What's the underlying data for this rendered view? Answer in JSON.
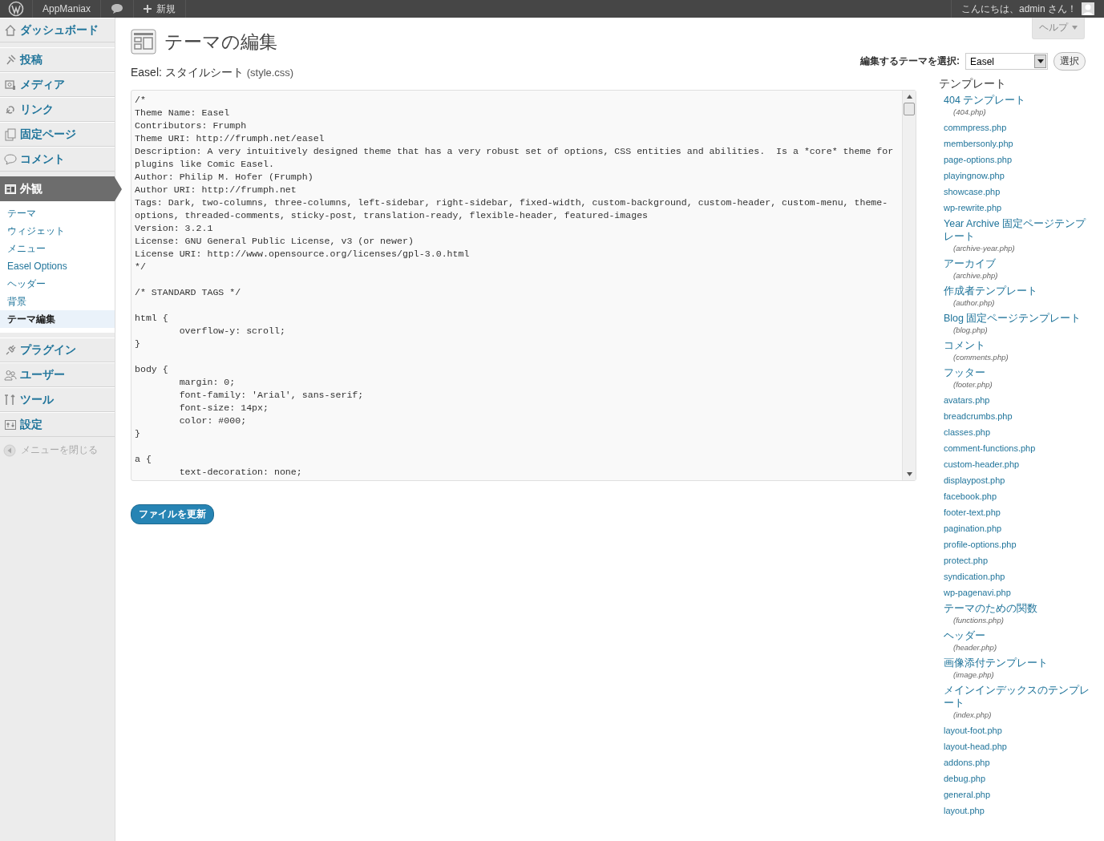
{
  "admin_bar": {
    "site": "AppManiax",
    "new": "新規",
    "greeting": "こんにちは、admin さん！"
  },
  "help": "ヘルプ",
  "menu": [
    {
      "label": "ダッシュボード",
      "selected": false
    },
    {
      "label": "投稿",
      "selected": false
    },
    {
      "label": "メディア",
      "selected": false
    },
    {
      "label": "リンク",
      "selected": false
    },
    {
      "label": "固定ページ",
      "selected": false
    },
    {
      "label": "コメント",
      "selected": false
    },
    {
      "label": "外観",
      "selected": true,
      "children": [
        {
          "label": "テーマ",
          "selected": false
        },
        {
          "label": "ウィジェット",
          "selected": false
        },
        {
          "label": "メニュー",
          "selected": false
        },
        {
          "label": "Easel Options",
          "selected": false
        },
        {
          "label": "ヘッダー",
          "selected": false
        },
        {
          "label": "背景",
          "selected": false
        },
        {
          "label": "テーマ編集",
          "selected": true
        }
      ]
    },
    {
      "label": "プラグイン",
      "selected": false
    },
    {
      "label": "ユーザー",
      "selected": false
    },
    {
      "label": "ツール",
      "selected": false
    },
    {
      "label": "設定",
      "selected": false
    }
  ],
  "menu_collapse": "メニューを閉じる",
  "page_title": "テーマの編集",
  "file_heading": {
    "title": "Easel: スタイルシート",
    "file": "(style.css)"
  },
  "theme_select": {
    "label": "編集するテーマを選択:",
    "value": "Easel",
    "button": "選択"
  },
  "code_blocks": [
    [
      "/*",
      "Theme Name: Easel",
      "Contributors: Frumph",
      "Theme URI: http://frumph.net/easel",
      "Description: A very intuitively designed theme that has a very robust set of options, CSS entities and abilities.  Is a *core* theme for",
      "plugins like Comic Easel.",
      "Author: Philip M. Hofer (Frumph)",
      "Author URI: http://frumph.net",
      "Tags: Dark, two-columns, three-columns, left-sidebar, right-sidebar, fixed-width, custom-background, custom-header, custom-menu, theme-",
      "options, threaded-comments, sticky-post, translation-ready, flexible-header, featured-images",
      "Version: 3.2.1",
      "License: GNU General Public License, v3 (or newer)",
      "License URI: http://www.opensource.org/licenses/gpl-3.0.html",
      "*/"
    ],
    [
      "/* STANDARD TAGS */"
    ],
    [
      "html {",
      "        overflow-y: scroll;",
      "}"
    ],
    [
      "body {",
      "        margin: 0;",
      "        font-family: 'Arial', sans-serif;",
      "        font-size: 14px;",
      "        color: #000;",
      "}"
    ],
    [
      "a {",
      "        text-decoration: none;"
    ]
  ],
  "update_button": "ファイルを更新",
  "templates_heading": "テンプレート",
  "templates": [
    {
      "name": "404 テンプレート",
      "file": "(404.php)"
    },
    {
      "name": "commpress.php"
    },
    {
      "name": "membersonly.php"
    },
    {
      "name": "page-options.php"
    },
    {
      "name": "playingnow.php"
    },
    {
      "name": "showcase.php"
    },
    {
      "name": "wp-rewrite.php"
    },
    {
      "name": "Year Archive 固定ページテンプレート",
      "file": "(archive-year.php)"
    },
    {
      "name": "アーカイブ",
      "file": "(archive.php)"
    },
    {
      "name": "作成者テンプレート",
      "file": "(author.php)"
    },
    {
      "name": "Blog 固定ページテンプレート",
      "file": "(blog.php)"
    },
    {
      "name": "コメント",
      "file": "(comments.php)"
    },
    {
      "name": "フッター",
      "file": "(footer.php)"
    },
    {
      "name": "avatars.php"
    },
    {
      "name": "breadcrumbs.php"
    },
    {
      "name": "classes.php"
    },
    {
      "name": "comment-functions.php"
    },
    {
      "name": "custom-header.php"
    },
    {
      "name": "displaypost.php"
    },
    {
      "name": "facebook.php"
    },
    {
      "name": "footer-text.php"
    },
    {
      "name": "pagination.php"
    },
    {
      "name": "profile-options.php"
    },
    {
      "name": "protect.php"
    },
    {
      "name": "syndication.php"
    },
    {
      "name": "wp-pagenavi.php"
    },
    {
      "name": "テーマのための関数",
      "file": "(functions.php)"
    },
    {
      "name": "ヘッダー",
      "file": "(header.php)"
    },
    {
      "name": "画像添付テンプレート",
      "file": "(image.php)"
    },
    {
      "name": "メインインデックスのテンプレート",
      "file": "(index.php)"
    },
    {
      "name": "layout-foot.php"
    },
    {
      "name": "layout-head.php"
    },
    {
      "name": "addons.php"
    },
    {
      "name": "debug.php"
    },
    {
      "name": "general.php"
    },
    {
      "name": "layout.php"
    }
  ]
}
